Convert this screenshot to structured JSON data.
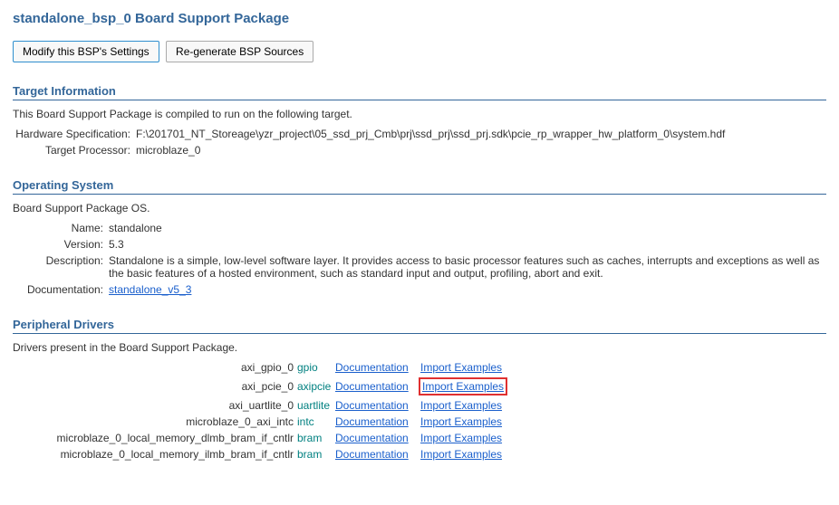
{
  "page_title": "standalone_bsp_0 Board Support Package",
  "toolbar": {
    "modify_label": "Modify this BSP's Settings",
    "regen_label": "Re-generate BSP Sources"
  },
  "target_info": {
    "header": "Target Information",
    "intro": "This Board Support Package is compiled to run on the following target.",
    "hw_spec_label": "Hardware Specification:",
    "hw_spec_value": "F:\\201701_NT_Storeage\\yzr_project\\05_ssd_prj_Cmb\\prj\\ssd_prj\\ssd_prj.sdk\\pcie_rp_wrapper_hw_platform_0\\system.hdf",
    "target_proc_label": "Target Processor:",
    "target_proc_value": "microblaze_0"
  },
  "os": {
    "header": "Operating System",
    "intro": "Board Support Package OS.",
    "name_label": "Name:",
    "name_value": "standalone",
    "version_label": "Version:",
    "version_value": "5.3",
    "desc_label": "Description:",
    "desc_value": "Standalone is a simple, low-level software layer. It provides access to basic processor features such as caches, interrupts and exceptions as well as the basic features of a hosted environment, such as standard input and output, profiling, abort and exit.",
    "doc_label": "Documentation:",
    "doc_link": "standalone_v5_3"
  },
  "drivers": {
    "header": "Peripheral Drivers",
    "intro": "Drivers present in the Board Support Package.",
    "doc_text": "Documentation",
    "import_text": "Import Examples",
    "items": [
      {
        "name": "axi_gpio_0",
        "driver": "gpio",
        "highlighted": false
      },
      {
        "name": "axi_pcie_0",
        "driver": "axipcie",
        "highlighted": true
      },
      {
        "name": "axi_uartlite_0",
        "driver": "uartlite",
        "highlighted": false
      },
      {
        "name": "microblaze_0_axi_intc",
        "driver": "intc",
        "highlighted": false
      },
      {
        "name": "microblaze_0_local_memory_dlmb_bram_if_cntlr",
        "driver": "bram",
        "highlighted": false
      },
      {
        "name": "microblaze_0_local_memory_ilmb_bram_if_cntlr",
        "driver": "bram",
        "highlighted": false
      }
    ]
  }
}
